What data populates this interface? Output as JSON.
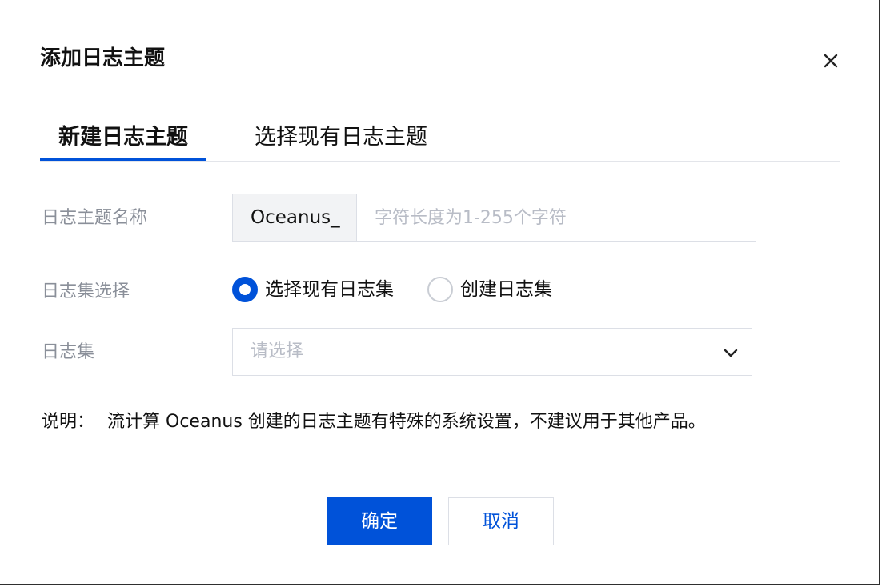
{
  "dialog": {
    "title": "添加日志主题",
    "close_icon": "close-icon"
  },
  "tabs": [
    {
      "label": "新建日志主题",
      "active": true
    },
    {
      "label": "选择现有日志主题",
      "active": false
    }
  ],
  "form": {
    "topic_name": {
      "label": "日志主题名称",
      "prefix": "Oceanus_",
      "value": "",
      "placeholder": "字符长度为1-255个字符"
    },
    "logset_choice": {
      "label": "日志集选择",
      "options": [
        {
          "label": "选择现有日志集",
          "checked": true
        },
        {
          "label": "创建日志集",
          "checked": false
        }
      ]
    },
    "logset": {
      "label": "日志集",
      "placeholder": "请选择",
      "icon": "chevron-down-icon"
    }
  },
  "note": {
    "prefix": "说明：",
    "text": "流计算 Oceanus 创建的日志主题有特殊的系统设置，不建议用于其他产品。"
  },
  "footer": {
    "confirm_label": "确定",
    "cancel_label": "取消"
  },
  "colors": {
    "primary": "#0052d9",
    "label_gray": "#8a8f99",
    "border": "#dcdfe6",
    "prefix_bg": "#f2f3f5"
  }
}
